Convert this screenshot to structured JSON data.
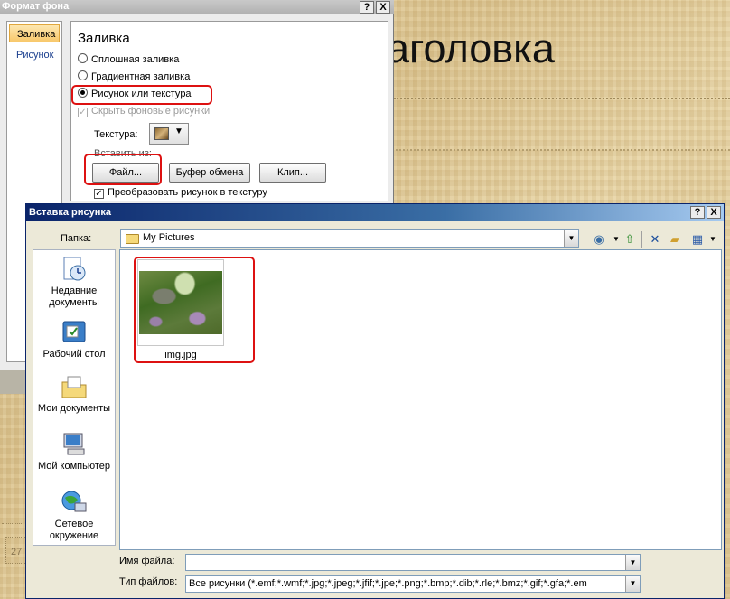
{
  "slide": {
    "title_fragment": "аголовка",
    "page_number": "27"
  },
  "format_dialog": {
    "title": "Формат фона",
    "help_label": "?",
    "close_label": "X",
    "sidebar": {
      "items": [
        {
          "label": "Заливка",
          "selected": true
        },
        {
          "label": "Рисунок",
          "selected": false
        }
      ]
    },
    "section_title": "Заливка",
    "options": [
      {
        "label": "Сплошная заливка",
        "checked": false
      },
      {
        "label": "Градиентная заливка",
        "checked": false
      },
      {
        "label": "Рисунок или текстура",
        "checked": true
      },
      {
        "label": "Скрыть фоновые рисунки",
        "checked": true,
        "disabled": true
      }
    ],
    "texture_label": "Текстура:",
    "insert_from_label": "Вставить из:",
    "buttons": {
      "file": "Файл...",
      "clipboard": "Буфер обмена",
      "clip": "Клип..."
    },
    "tile_label": "Преобразовать рисунок в текстуру",
    "tile_checked": true
  },
  "insert_dialog": {
    "title": "Вставка рисунка",
    "help_label": "?",
    "close_label": "X",
    "folder_label": "Папка:",
    "folder_value": "My Pictures",
    "places": [
      {
        "label": "Недавние документы",
        "icon": "recent-documents-icon"
      },
      {
        "label": "Рабочий стол",
        "icon": "desktop-icon"
      },
      {
        "label": "Мои документы",
        "icon": "my-documents-icon"
      },
      {
        "label": "Мой компьютер",
        "icon": "my-computer-icon"
      },
      {
        "label": "Сетевое окружение",
        "icon": "network-icon"
      }
    ],
    "files": [
      {
        "name": "img.jpg"
      }
    ],
    "filename_label": "Имя файла:",
    "filename_value": "",
    "filetype_label": "Тип файлов:",
    "filetype_value": "Все рисунки (*.emf;*.wmf;*.jpg;*.jpeg;*.jfif;*.jpe;*.png;*.bmp;*.dib;*.rle;*.bmz;*.gif;*.gfa;*.em"
  },
  "colors": {
    "highlight_outline": "#dd1111",
    "titlebar_active": "#0a246a",
    "titlebar_inactive": "#b0b0b0"
  }
}
